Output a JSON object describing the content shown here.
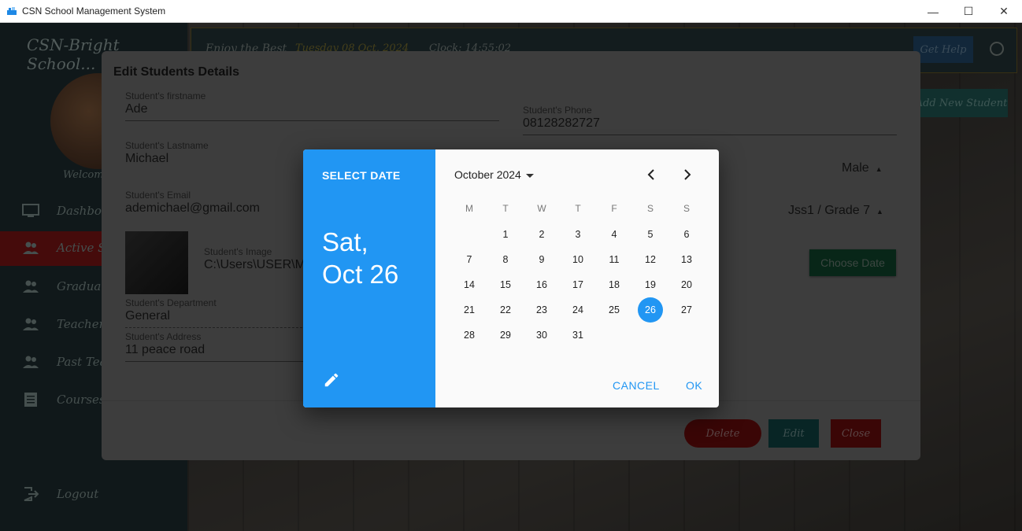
{
  "window": {
    "title": "CSN School Management System",
    "minimize_label": "—",
    "maximize_label": "☐",
    "close_label": "✕"
  },
  "sidebar": {
    "brand": "CSN-Bright School...",
    "welcome": "Welcome",
    "items": [
      {
        "label": "Dashboard",
        "icon": "monitor-icon"
      },
      {
        "label": "Active Students",
        "icon": "people-icon"
      },
      {
        "label": "Graduates",
        "icon": "people-icon"
      },
      {
        "label": "Teachers",
        "icon": "people-icon"
      },
      {
        "label": "Past Teachers",
        "icon": "people-icon"
      },
      {
        "label": "Courses",
        "icon": "list-icon"
      }
    ],
    "logout": "Logout"
  },
  "topbar": {
    "enjoy": "Enjoy the Best",
    "date": "Tuesday 08 Oct, 2024",
    "clock": "Clock: 14:55:02",
    "help": "Get Help"
  },
  "add_new": "Add New Student",
  "edit_dialog": {
    "title": "Edit Students Details",
    "firstname_label": "Student's firstname",
    "firstname": "Ade",
    "lastname_label": "Student's Lastname",
    "lastname": "Michael",
    "email_label": "Student's Email",
    "email": "ademichael@gmail.com",
    "image_label": "Student's Image",
    "image_path": "C:\\Users\\USER\\M",
    "department_label": "Student's Department",
    "department": "General",
    "address_label": "Student's Address",
    "address": "11 peace road",
    "phone_label": "Student's Phone",
    "phone": "08128282727",
    "gender": "Male",
    "grade": "Jss1 / Grade 7",
    "choose_date": "Choose Date",
    "delete": "Delete",
    "edit": "Edit",
    "close": "Close"
  },
  "date_picker": {
    "header": "SELECT DATE",
    "selected_line1": "Sat,",
    "selected_line2": "Oct 26",
    "month_label": "October 2024",
    "weekdays": [
      "M",
      "T",
      "W",
      "T",
      "F",
      "S",
      "S"
    ],
    "first_weekday_index": 1,
    "days_in_month": 31,
    "selected_day": 26,
    "cancel": "CANCEL",
    "ok": "OK",
    "accent": "#2196f3"
  }
}
